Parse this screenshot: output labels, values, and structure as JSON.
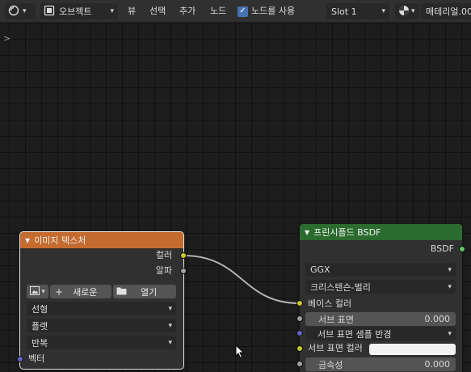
{
  "header": {
    "object_mode": "오브젝트",
    "menu": {
      "view": "뷰",
      "select": "선택",
      "add": "추가",
      "node": "노드"
    },
    "use_nodes": {
      "label": "노드를 사용",
      "checked": true
    },
    "slot": "Slot 1",
    "material": "매테리얼.00"
  },
  "icons": {
    "editor_type": "node-editor-icon",
    "object_mode": "object-mode-icon",
    "material_preview": "material-sphere-icon",
    "sidebar_toggle": "chevron-right-icon",
    "image_browse": "image-icon",
    "new": "plus-icon",
    "open": "folder-icon",
    "cursor": "mouse-cursor-icon"
  },
  "image_texture_node": {
    "title": "이미지 텍스처",
    "header_color": "#c46b2f",
    "outputs": {
      "color": "컬러",
      "alpha": "알파"
    },
    "new_label": "새로운",
    "open_label": "열기",
    "interpolation": "선형",
    "projection": "플랫",
    "extension": "반복",
    "input_vector": "벡터"
  },
  "principled_node": {
    "title": "프린시플드 BSDF",
    "header_color": "#2b6b2f",
    "output_bsdf": "BSDF",
    "distribution": "GGX",
    "subsurface_method": "크리스텐슨-벌리",
    "base_color_label": "베이스 컬러",
    "subsurface_label": "서브 표면",
    "subsurface_value": "0.000",
    "subsurface_radius_label": "서브 표면 샘플 반경",
    "subsurface_color_label": "서브 표면 컬러",
    "metallic_label": "금속성",
    "metallic_value": "0.000"
  },
  "colors": {
    "socket_color": "#c7c729",
    "socket_float": "#a1a1a1",
    "socket_vector": "#6363c7",
    "socket_shader": "#63c763",
    "accent_blue": "#4772b3"
  }
}
